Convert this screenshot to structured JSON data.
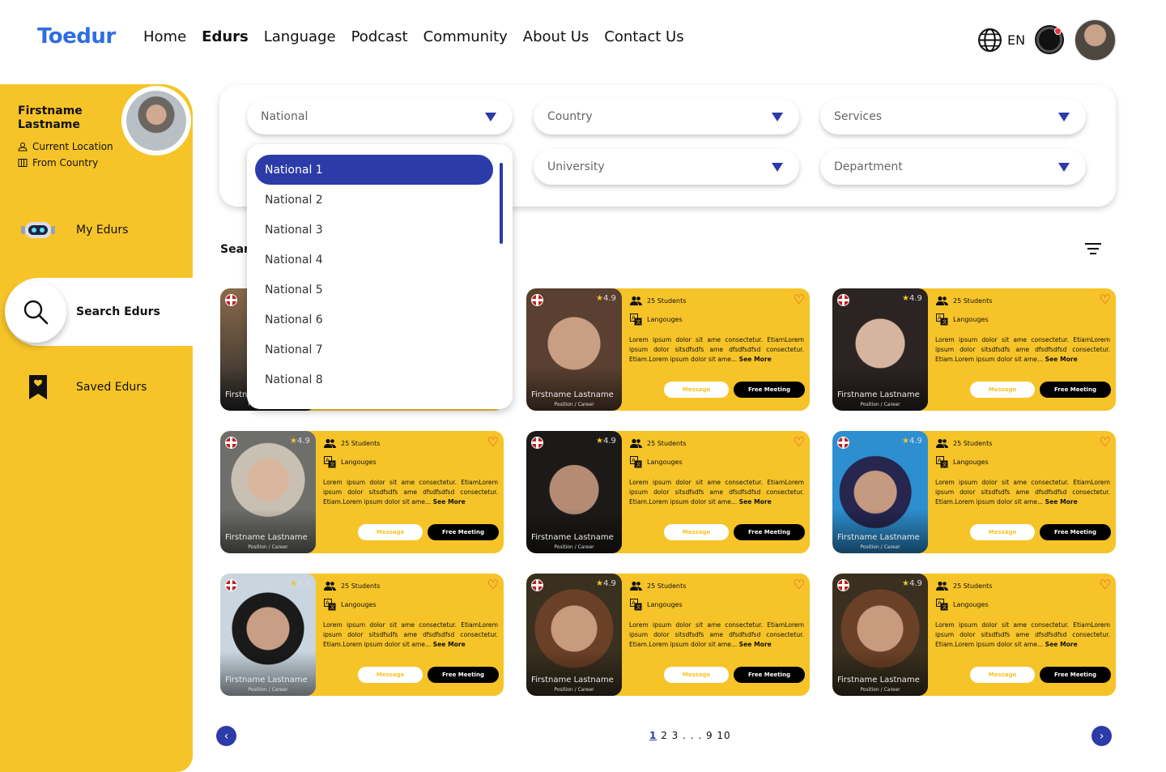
{
  "brand": "Toedur",
  "nav": [
    "Home",
    "Edurs",
    "Language",
    "Podcast",
    "Community",
    "About Us",
    "Contact Us"
  ],
  "lang": "EN",
  "profile": {
    "name": "Firstname Lastname",
    "location": "Current Location",
    "country": "From Country"
  },
  "sidebar": [
    {
      "label": "My Edurs",
      "icon": "robot-icon"
    },
    {
      "label": "Search Edurs",
      "icon": "search-icon"
    },
    {
      "label": "Saved Edurs",
      "icon": "bookmark-icon"
    }
  ],
  "filters": {
    "national": "National",
    "country": "Country",
    "services": "Services",
    "university": "University",
    "department": "Department"
  },
  "dropdown": [
    "National 1",
    "National 2",
    "National 3",
    "National 4",
    "National 5",
    "National 6",
    "National 7",
    "National 8"
  ],
  "search_label": "Sear",
  "card": {
    "rating": "4.9",
    "students": "25 Students",
    "languages": "Langouges",
    "desc": "Lorem ipsum dolor sit ame consectetur. EtiamLorem ipsum dolor sitsdfsdfs ame dfsdfsdfsd consectetur. Etiam.Lorem ipsum dolor sit ame...",
    "see_more": "See More",
    "name": "Firstname Lastname",
    "position": "Position / Career",
    "message": "Message",
    "meeting": "Free Meeting"
  },
  "pagination": {
    "current": "1",
    "rest": "2 3 . . . 9 10",
    "prev": "‹",
    "next": "›"
  },
  "colors": {
    "accent": "#2b3ba8",
    "brand": "#2f6ee0",
    "yellow": "#f6c428"
  }
}
